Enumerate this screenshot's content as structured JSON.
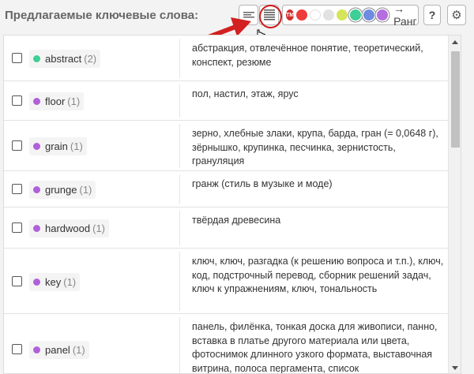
{
  "header": {
    "title": "Предлагаемые ключевые слова:",
    "rank_label": "→ Ранг",
    "help_label": "?",
    "tm_badge": "TM",
    "filter_colors": [
      {
        "name": "red-dot",
        "color": "#ee3b3b"
      },
      {
        "name": "white-dot",
        "color": "#ffffff"
      },
      {
        "name": "gray-dot",
        "color": "#e2e2e2"
      },
      {
        "name": "yellow-dot",
        "color": "#d6e45b"
      },
      {
        "name": "green-dot",
        "color": "#3fce96",
        "selected": true
      },
      {
        "name": "blue-dot",
        "color": "#6f8ce0",
        "selected": true
      },
      {
        "name": "purple-dot",
        "color": "#b46ede",
        "selected": true
      }
    ]
  },
  "colors": {
    "green": "#3fce96",
    "purple": "#b061d8",
    "highlight_red": "#cc1b1b"
  },
  "keywords": [
    {
      "word": "abstract",
      "count": "(2)",
      "dot": "green",
      "translation": "абстракция, отвлечённое понятие, теоретический, конспект, резюме"
    },
    {
      "word": "floor",
      "count": "(1)",
      "dot": "purple",
      "translation": "пол, настил, этаж, ярус"
    },
    {
      "word": "grain",
      "count": "(1)",
      "dot": "purple",
      "translation": "зерно, хлебные злаки, крупа, барда, гран (= 0,0648 г), зёрнышко, крупинка, песчинка, зернистость, грануляция"
    },
    {
      "word": "grunge",
      "count": "(1)",
      "dot": "purple",
      "translation": "гранж (стиль в музыке и моде)"
    },
    {
      "word": "hardwood",
      "count": "(1)",
      "dot": "purple",
      "translation": "твёрдая древесина"
    },
    {
      "word": "key",
      "count": "(1)",
      "dot": "purple",
      "translation": "ключ, ключ, разгадка (к решению вопроса и т.п.), ключ, код, подстрочный перевод, сборник решений задач, ключ к упражнениям, ключ, тональность"
    },
    {
      "word": "panel",
      "count": "(1)",
      "dot": "purple",
      "translation": "панель, филёнка, тонкая доска для живописи, панно, вставка в платье другого материала или цвета, фотоснимок длинного узкого формата, выставочная витрина, полоса пергамента, список"
    }
  ]
}
